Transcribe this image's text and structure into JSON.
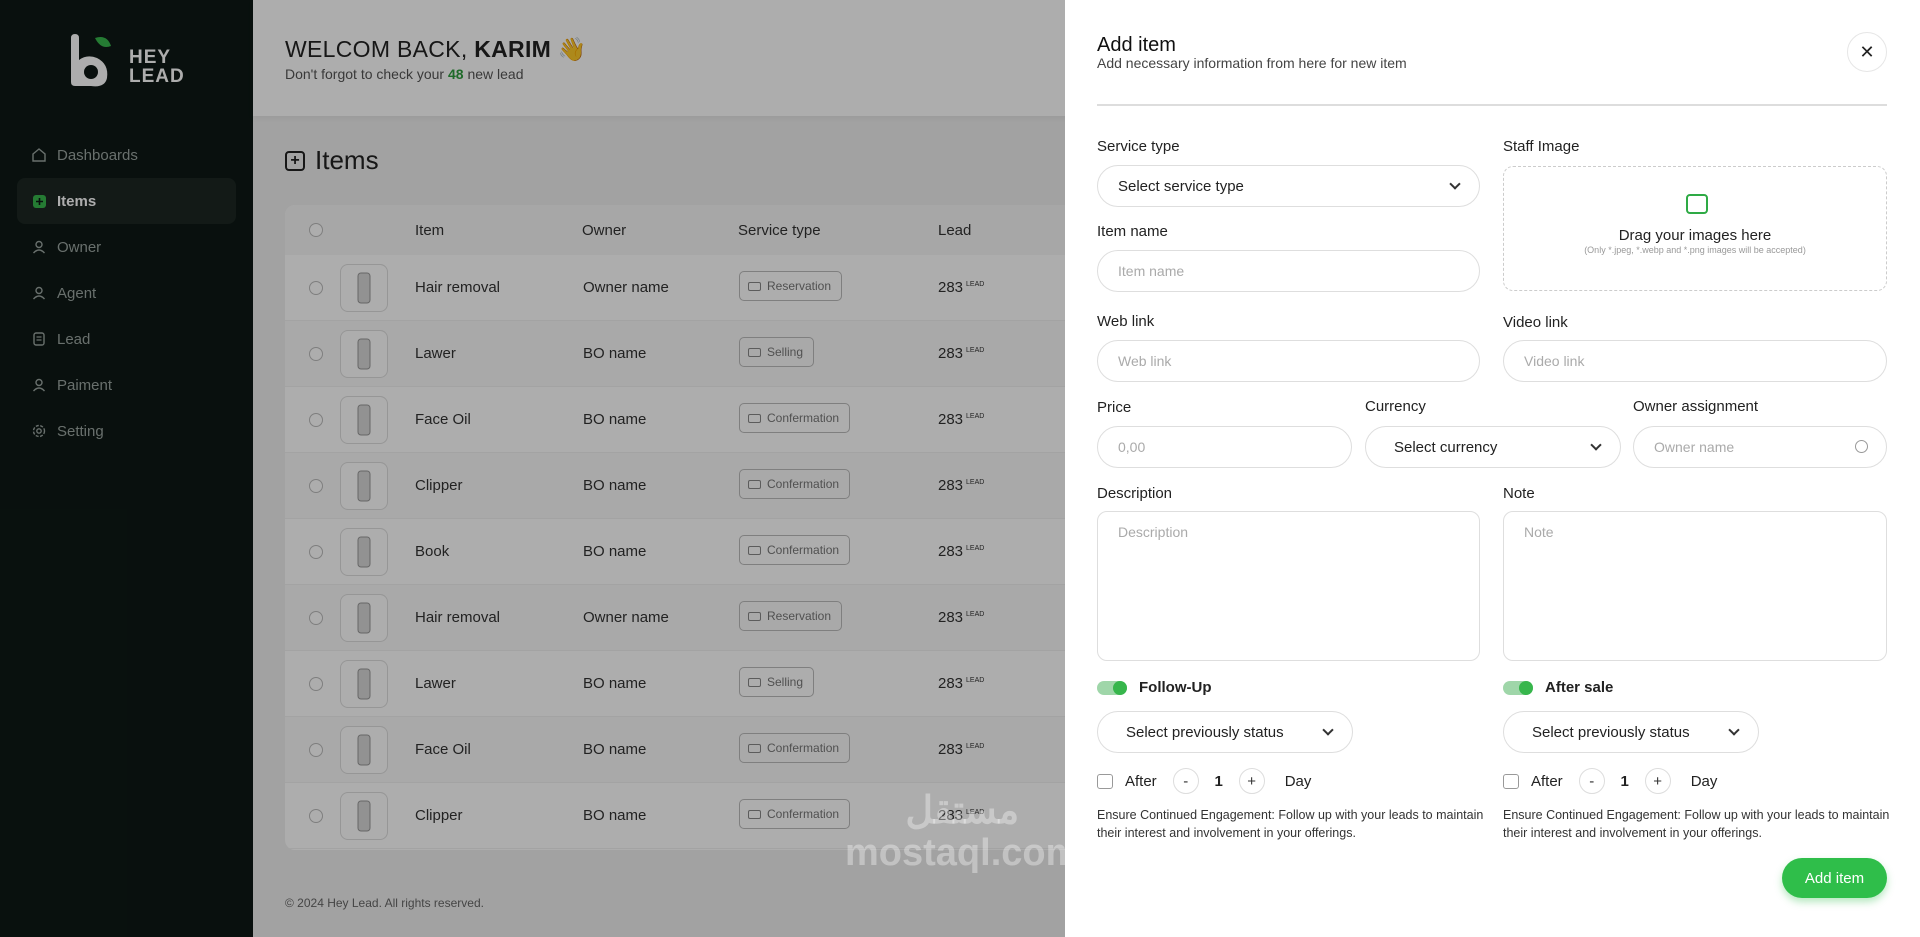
{
  "sidebar": {
    "logo": "HEY LEAD",
    "logo_lines": [
      "HEY",
      "LEAD"
    ],
    "items": [
      {
        "label": "Dashboards",
        "icon": "home-icon"
      },
      {
        "label": "Items",
        "icon": "plus-square-icon",
        "active": true
      },
      {
        "label": "Owner",
        "icon": "user-icon"
      },
      {
        "label": "Agent",
        "icon": "user-icon"
      },
      {
        "label": "Lead",
        "icon": "document-icon"
      },
      {
        "label": "Paiment",
        "icon": "user-icon"
      },
      {
        "label": "Setting",
        "icon": "gear-icon"
      }
    ]
  },
  "header": {
    "welcome_prefix": "WELCOM BACK,",
    "user_name": "KARIM",
    "wave": "👋",
    "sub_prefix": "Don't forgot to check your",
    "lead_count": "48",
    "sub_suffix": "new lead"
  },
  "page": {
    "title": "Items"
  },
  "table": {
    "columns": [
      "Item",
      "Owner",
      "Service type",
      "Lead"
    ],
    "lead_unit": "LEAD",
    "rows": [
      {
        "item": "Hair removal",
        "owner": "Owner name",
        "service": "Reservation",
        "lead": "283"
      },
      {
        "item": "Lawer",
        "owner": "BO name",
        "service": "Selling",
        "lead": "283"
      },
      {
        "item": "Face Oil",
        "owner": "BO name",
        "service": "Confermation",
        "lead": "283"
      },
      {
        "item": "Clipper",
        "owner": "BO name",
        "service": "Confermation",
        "lead": "283"
      },
      {
        "item": "Book",
        "owner": "BO name",
        "service": "Confermation",
        "lead": "283"
      },
      {
        "item": "Hair removal",
        "owner": "Owner name",
        "service": "Reservation",
        "lead": "283"
      },
      {
        "item": "Lawer",
        "owner": "BO name",
        "service": "Selling",
        "lead": "283"
      },
      {
        "item": "Face Oil",
        "owner": "BO name",
        "service": "Confermation",
        "lead": "283"
      },
      {
        "item": "Clipper",
        "owner": "BO name",
        "service": "Confermation",
        "lead": "283"
      }
    ]
  },
  "footer": "© 2024 Hey Lead. All rights reserved.",
  "watermark": {
    "arabic": "مستقل",
    "latin": "mostaql.com"
  },
  "drawer": {
    "title": "Add item",
    "subtitle": "Add necessary information from here for new item",
    "service_type_label": "Service type",
    "service_type_value": "Select service type",
    "staff_image_label": "Staff Image",
    "drop_title": "Drag your images here",
    "drop_hint": "(Only *.jpeg, *.webp and *.png images will be accepted)",
    "item_name_label": "Item name",
    "item_name_placeholder": "Item name",
    "web_link_label": "Web link",
    "web_link_placeholder": "Web link",
    "video_link_label": "Video link",
    "video_link_placeholder": "Video link",
    "price_label": "Price",
    "price_placeholder": "0,00",
    "currency_label": "Currency",
    "currency_value": "Select currency",
    "owner_label": "Owner assignment",
    "owner_placeholder": "Owner name",
    "description_label": "Description",
    "description_placeholder": "Description",
    "note_label": "Note",
    "note_placeholder": "Note",
    "followup": {
      "label": "Follow-Up",
      "status": "Select previously status",
      "after": "After",
      "minus": "-",
      "count": "1",
      "plus": "+",
      "unit": "Day",
      "hint": "Ensure Continued Engagement: Follow up with your leads to maintain their interest and involvement in your offerings."
    },
    "aftersale": {
      "label": "After sale",
      "status": "Select previously status",
      "after": "After",
      "minus": "-",
      "count": "1",
      "plus": "+",
      "unit": "Day",
      "hint": "Ensure Continued Engagement: Follow up with your leads to maintain their interest and involvement in your offerings."
    },
    "submit_label": "Add item"
  },
  "colors": {
    "accent": "#2fbe4a",
    "sidebar_bg": "#0e1915"
  }
}
